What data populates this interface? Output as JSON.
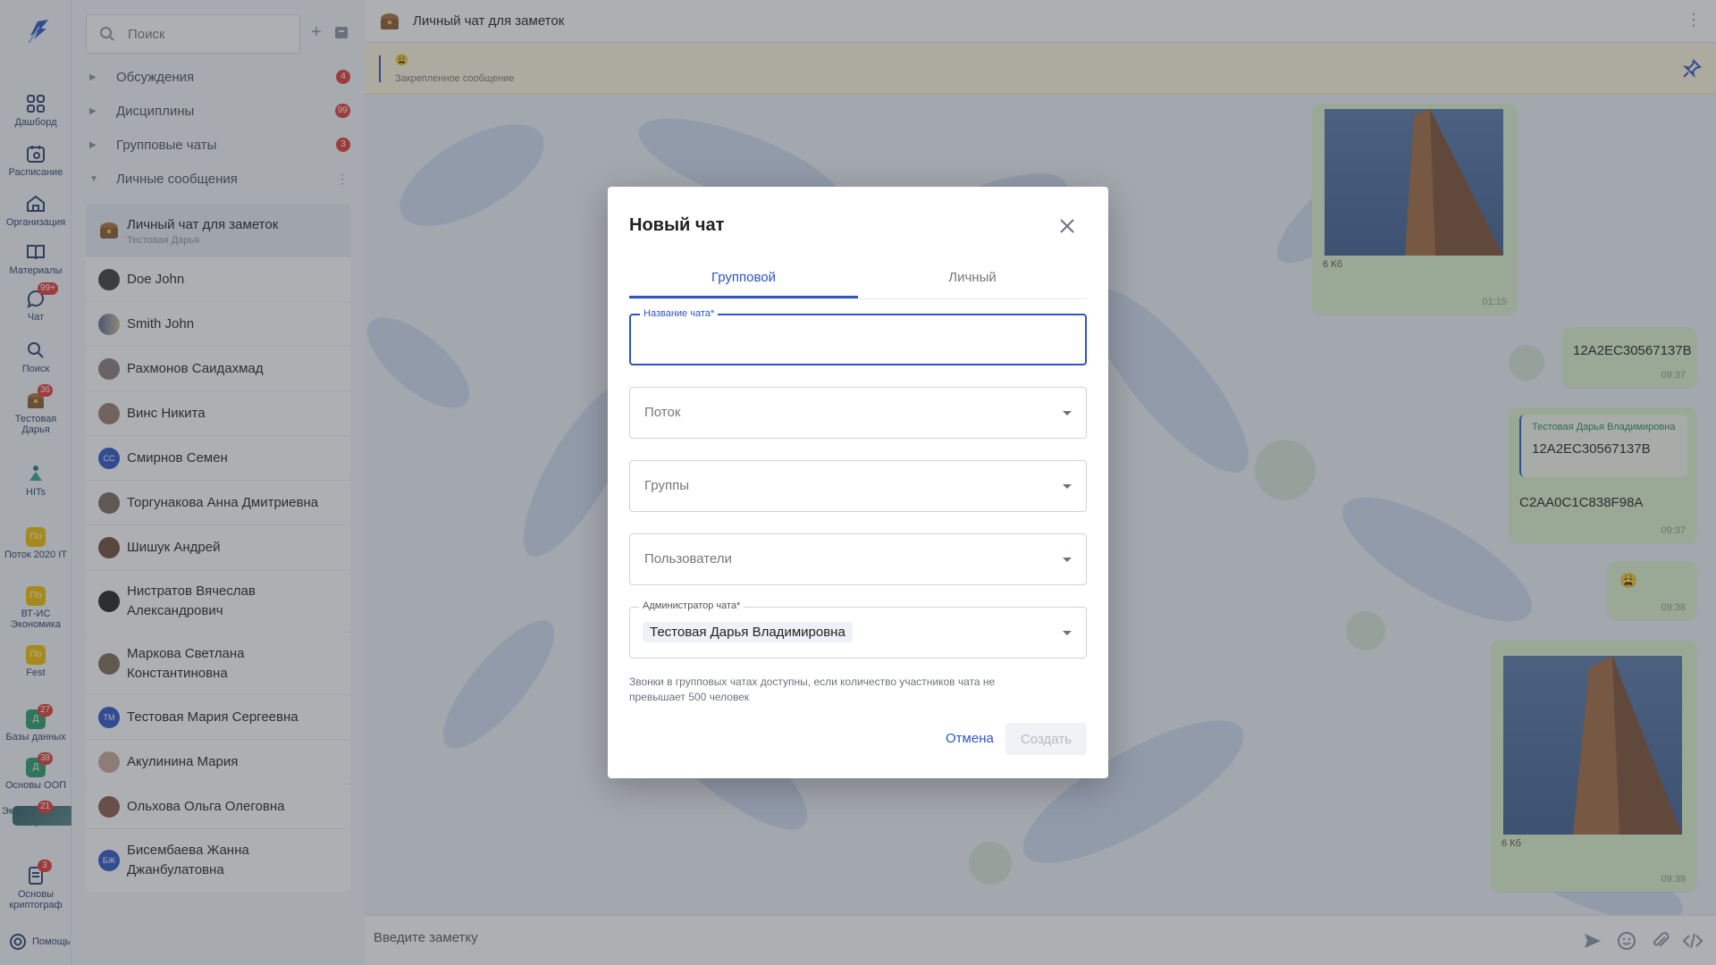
{
  "rail": {
    "items": [
      {
        "label": "Дашборд"
      },
      {
        "label": "Расписание"
      },
      {
        "label": "Организация"
      },
      {
        "label": "Материалы"
      },
      {
        "label": "Чат",
        "badge": "99+"
      },
      {
        "label": "Поиск"
      },
      {
        "label": "Тестовая Дарья",
        "badge": "36"
      },
      {
        "label": "HITs"
      },
      {
        "label": "Поток 2020 IT",
        "icon_text": "По"
      },
      {
        "label": "ВТ-ИС Экономика",
        "icon_text": "По"
      },
      {
        "label": "Fest",
        "icon_text": "По"
      },
      {
        "label": "Базы данных",
        "icon_text": "Д",
        "badge": "27"
      },
      {
        "label": "Основы ООП",
        "icon_text": "Д",
        "badge": "38"
      },
      {
        "label": "Экономическая теория",
        "badge": "21"
      },
      {
        "label": "Основы криптограф",
        "badge": "3"
      }
    ],
    "help_label": "Помощь"
  },
  "panel": {
    "search_placeholder": "Поиск",
    "sections": [
      {
        "label": "Обсуждения",
        "badge": "4"
      },
      {
        "label": "Дисциплины",
        "badge": "99"
      },
      {
        "label": "Групповые чаты",
        "badge": "3"
      },
      {
        "label": "Личные сообщения"
      }
    ],
    "chats": [
      {
        "name": "Личный чат для заметок",
        "sub": "Тестовая Дарья"
      },
      {
        "name": "Doe John"
      },
      {
        "name": "Smith John"
      },
      {
        "name": "Рахмонов Саидахмад"
      },
      {
        "name": "Винс Никита"
      },
      {
        "name": "Смирнов Семен",
        "initials": "СС"
      },
      {
        "name": "Торгунакова Анна Дмитриевна"
      },
      {
        "name": "Шишук Андрей"
      },
      {
        "name": "Нистратов Вячеслав Александрович"
      },
      {
        "name": "Маркова Светлана Константиновна"
      },
      {
        "name": "Тестовая Мария Сергеевна",
        "initials": "ТМ"
      },
      {
        "name": "Акулинина Мария"
      },
      {
        "name": "Ольхова Ольга Олеговна"
      },
      {
        "name": "Бисембаева Жанна Джанбулатовна",
        "initials": "БЖ"
      }
    ]
  },
  "main": {
    "title": "Личный чат для заметок",
    "pinned_emoji": "😩",
    "pinned_label": "Закрепленное сообщение",
    "messages": [
      {
        "size": "6 Кб",
        "time": "01:15"
      },
      {
        "text": "12A2EC30567137B",
        "time": "09:37"
      },
      {
        "quote_author": "Тестовая Дарья Владимировна",
        "quote_text": "12A2EC30567137B",
        "text": "C2AA0C1C838F98A",
        "time": "09:37"
      },
      {
        "text": "😩",
        "time": "09:38"
      },
      {
        "size": "6 Кб",
        "time": "09:39"
      }
    ],
    "composer_placeholder": "Введите заметку"
  },
  "dialog": {
    "title": "Новый чат",
    "tabs": [
      "Групповой",
      "Личный"
    ],
    "name_label": "Название чата*",
    "stream_placeholder": "Поток",
    "groups_placeholder": "Группы",
    "users_placeholder": "Пользователи",
    "admin_label": "Администратор чата*",
    "admin_value": "Тестовая Дарья Владимировна",
    "hint": "Звонки в групповых чатах доступны, если количество участников чата не превышает 500 человек",
    "cancel": "Отмена",
    "create": "Создать"
  },
  "colors": {
    "accent": "#2d55c6",
    "badge": "#e53935",
    "bubble": "#dff3cf",
    "pinned_bg": "#fff9e0"
  }
}
